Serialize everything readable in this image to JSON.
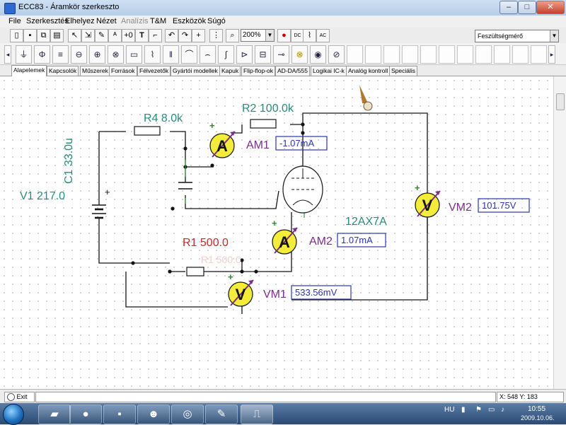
{
  "window": {
    "title": "ECC83 - Áramkör szerkeszto",
    "minimize_label": "–",
    "maximize_label": "□",
    "close_label": "✕"
  },
  "menu": {
    "items": [
      "File",
      "Szerkesztés",
      "Elhelyez",
      "Nézet",
      "Analízis",
      "T&M",
      "Eszközök",
      "Súgó"
    ],
    "disabled_item": "Analízis"
  },
  "toolbar": {
    "zoom_value": "200%",
    "instrument_select": "Feszültségmérő",
    "text_tool_label": "T",
    "probe_label": "+0",
    "dc_label": "DC",
    "ac_label": "AC"
  },
  "component_palette": {
    "icons": [
      "ground-icon",
      "ammeter-icon",
      "battery-icon",
      "voltage-source-icon",
      "current-source-icon",
      "meter-icon",
      "resistor-icon",
      "switch-icon",
      "capacitor-icon",
      "inductor-icon",
      "transformer-icon",
      "coil-icon",
      "diode-icon",
      "cable-icon",
      "switch-icon",
      "lamp-icon",
      "motor-icon",
      "potentiometer-icon"
    ]
  },
  "tabs": {
    "items": [
      "Alapelemek",
      "Kapcsolók",
      "Műszerek",
      "Források",
      "Félvezetők",
      "Gyártói modellek",
      "Kapuk",
      "Flip-flop-ok",
      "AD-DA/555",
      "Logikai IC-k",
      "Analóg kontroll",
      "Speciális"
    ],
    "active_index": 0
  },
  "circuit": {
    "components": {
      "r4": "R4 8.0k",
      "r2": "R2 100.0k",
      "c1": "C1 33.0u",
      "v1": "V1 217.0",
      "r1": "R1 500.0",
      "r1_ghost": "R1 500.0",
      "tube": "12AX7A"
    },
    "meters": {
      "am1": {
        "name": "AM1",
        "symbol": "A",
        "reading": "-1.07mA"
      },
      "am2": {
        "name": "AM2",
        "symbol": "A",
        "reading": "1.07mA"
      },
      "vm1": {
        "name": "VM1",
        "symbol": "V",
        "reading": "533.56mV"
      },
      "vm2": {
        "name": "VM2",
        "symbol": "V",
        "reading": "101.75V"
      }
    },
    "plus_sign": "+",
    "colors": {
      "wire": "#141414",
      "lead": "#3a9a3a",
      "component_label": "#2a8a7a",
      "meter_label": "#7a2c8a",
      "r1_label": "#c62828",
      "meter_fill": "#f4ec3a",
      "reading_border": "#2b37b0"
    }
  },
  "status": {
    "left_label": "Exit",
    "coords": "X: 548  Y: 183"
  },
  "taskbar": {
    "language": "HU",
    "time": "10:55",
    "date": "2009.10.06."
  }
}
